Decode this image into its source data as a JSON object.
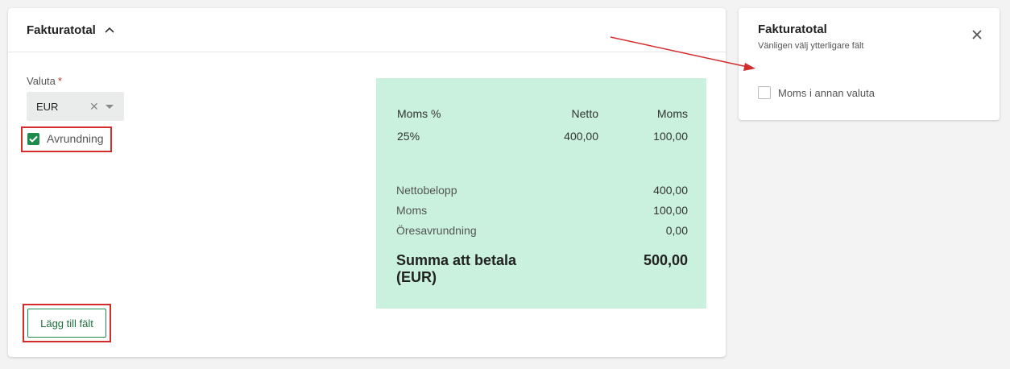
{
  "main": {
    "title": "Fakturatotal",
    "currency_label": "Valuta",
    "required_mark": "*",
    "currency_value": "EUR",
    "rounding_label": "Avrundning",
    "rounding_checked": true,
    "add_field_label": "Lägg till fält"
  },
  "totals": {
    "vat_header": "Moms %",
    "net_header": "Netto",
    "vat_amount_header": "Moms",
    "row_vat_pct": "25%",
    "row_net": "400,00",
    "row_vat": "100,00",
    "net_amount_label": "Nettobelopp",
    "net_amount_value": "400,00",
    "vat_label": "Moms",
    "vat_value": "100,00",
    "rounding_label": "Öresavrundning",
    "rounding_value": "0,00",
    "total_label_line1": "Summa att betala",
    "total_label_line2": "(EUR)",
    "total_value": "500,00"
  },
  "side_panel": {
    "title": "Fakturatotal",
    "subtitle": "Vänligen välj ytterligare fält",
    "option_label": "Moms i annan valuta",
    "option_checked": false
  },
  "colors": {
    "accent_green": "#1e8a4c",
    "totals_bg": "#c9f1dd",
    "highlight_red": "#d42b2b"
  },
  "icons": [
    "chevron-up-icon",
    "close-icon",
    "dropdown-caret-icon",
    "clear-icon",
    "checkmark-icon"
  ]
}
